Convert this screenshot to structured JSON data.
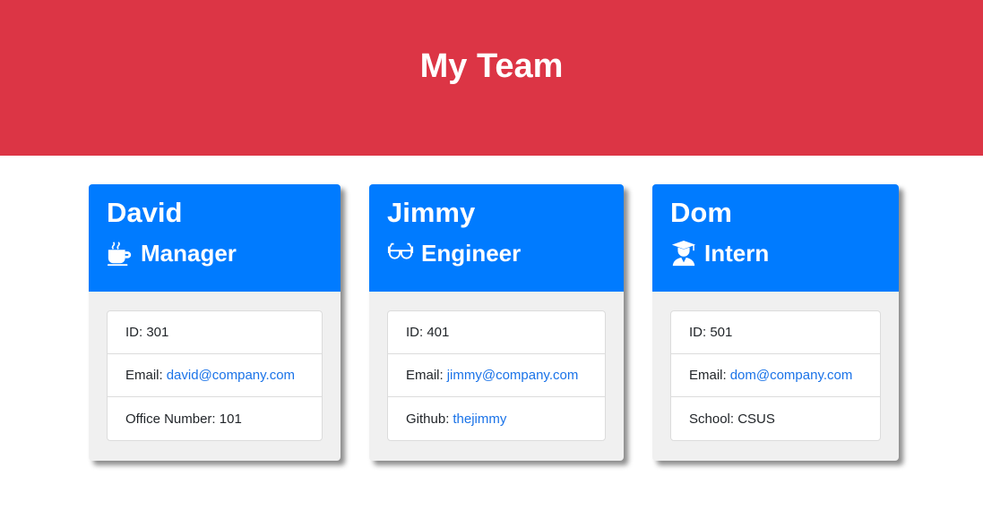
{
  "header": {
    "title": "My Team"
  },
  "colors": {
    "header_bg": "#dc3545",
    "card_header_bg": "#007bff",
    "link": "#1a73e8"
  },
  "cards": [
    {
      "name": "David",
      "role": "Manager",
      "icon": "coffee-icon",
      "id_label": "ID:",
      "id_value": "301",
      "email_label": "Email:",
      "email_value": "david@company.com",
      "extra_label": "Office Number:",
      "extra_value": "101"
    },
    {
      "name": "Jimmy",
      "role": "Engineer",
      "icon": "glasses-icon",
      "id_label": "ID:",
      "id_value": "401",
      "email_label": "Email:",
      "email_value": "jimmy@company.com",
      "extra_label": "Github:",
      "extra_value": "thejimmy"
    },
    {
      "name": "Dom",
      "role": "Intern",
      "icon": "graduate-icon",
      "id_label": "ID:",
      "id_value": "501",
      "email_label": "Email:",
      "email_value": "dom@company.com",
      "extra_label": "School:",
      "extra_value": "CSUS"
    }
  ]
}
